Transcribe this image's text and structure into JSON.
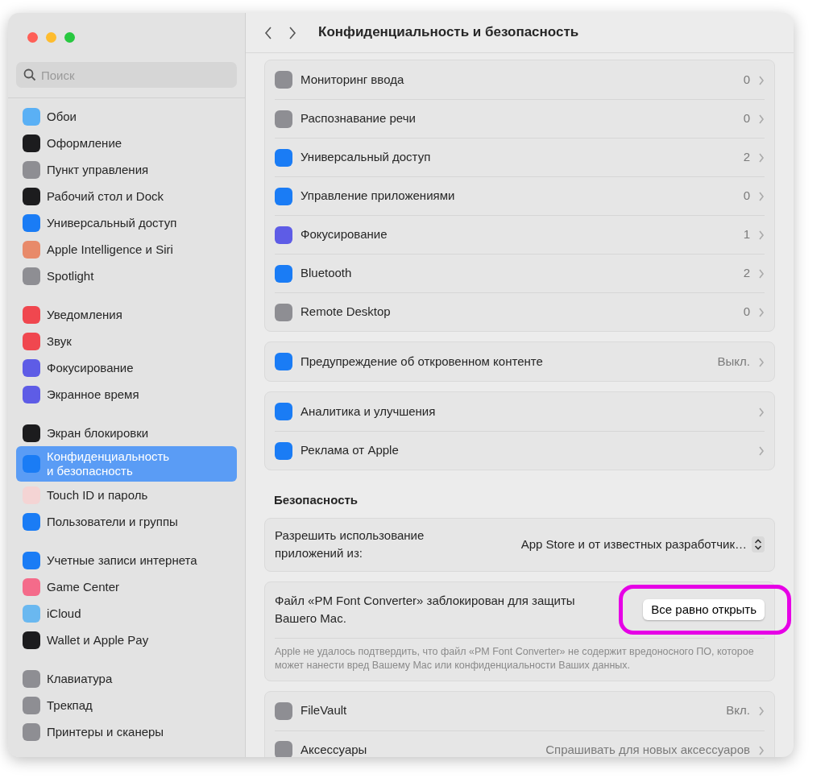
{
  "window": {
    "title": "Конфиденциальность и безопасность"
  },
  "search": {
    "placeholder": "Поиск"
  },
  "sidebar": {
    "groups": [
      [
        {
          "label": "Обои",
          "color": "#5ab0f5",
          "selected": false
        },
        {
          "label": "Оформление",
          "color": "#1c1c1e",
          "selected": false
        },
        {
          "label": "Пункт управления",
          "color": "#8e8e93",
          "selected": false
        },
        {
          "label": "Рабочий стол и Dock",
          "color": "#1c1c1e",
          "selected": false
        },
        {
          "label": "Универсальный доступ",
          "color": "#1a7cf5",
          "selected": false
        },
        {
          "label": "Apple Intelligence и Siri",
          "color": "#e88a6a",
          "selected": false
        },
        {
          "label": "Spotlight",
          "color": "#8e8e93",
          "selected": false
        }
      ],
      [
        {
          "label": "Уведомления",
          "color": "#f0474f",
          "selected": false
        },
        {
          "label": "Звук",
          "color": "#f0474f",
          "selected": false
        },
        {
          "label": "Фокусирование",
          "color": "#5e5ce6",
          "selected": false
        },
        {
          "label": "Экранное время",
          "color": "#5e5ce6",
          "selected": false
        }
      ],
      [
        {
          "label": "Экран блокировки",
          "color": "#1c1c1e",
          "selected": false
        },
        {
          "label": "Конфиденциальность\nи безопасность",
          "color": "#1a7cf5",
          "selected": true
        },
        {
          "label": "Touch ID и пароль",
          "color": "#f4d4d4",
          "selected": false
        },
        {
          "label": "Пользователи и группы",
          "color": "#1a7cf5",
          "selected": false
        }
      ],
      [
        {
          "label": "Учетные записи интернета",
          "color": "#1a7cf5",
          "selected": false
        },
        {
          "label": "Game Center",
          "color": "#f46b8a",
          "selected": false
        },
        {
          "label": "iCloud",
          "color": "#6ab8f0",
          "selected": false
        },
        {
          "label": "Wallet и Apple Pay",
          "color": "#1c1c1e",
          "selected": false
        }
      ],
      [
        {
          "label": "Клавиатура",
          "color": "#8e8e93",
          "selected": false
        },
        {
          "label": "Трекпад",
          "color": "#8e8e93",
          "selected": false
        },
        {
          "label": "Принтеры и сканеры",
          "color": "#8e8e93",
          "selected": false
        }
      ]
    ]
  },
  "privacy_groups": [
    [
      {
        "label": "Мониторинг ввода",
        "value": "0",
        "color": "#8e8e93"
      },
      {
        "label": "Распознавание речи",
        "value": "0",
        "color": "#8e8e93"
      },
      {
        "label": "Универсальный доступ",
        "value": "2",
        "color": "#1a7cf5"
      },
      {
        "label": "Управление приложениями",
        "value": "0",
        "color": "#1a7cf5"
      },
      {
        "label": "Фокусирование",
        "value": "1",
        "color": "#5e5ce6"
      },
      {
        "label": "Bluetooth",
        "value": "2",
        "color": "#1a7cf5"
      },
      {
        "label": "Remote Desktop",
        "value": "0",
        "color": "#8e8e93"
      }
    ],
    [
      {
        "label": "Предупреждение об откровенном контенте",
        "value": "Выкл.",
        "color": "#1a7cf5"
      }
    ],
    [
      {
        "label": "Аналитика и улучшения",
        "color": "#1a7cf5"
      },
      {
        "label": "Реклама от Apple",
        "color": "#1a7cf5"
      }
    ]
  ],
  "security": {
    "heading": "Безопасность",
    "allow": {
      "label": "Разрешить использование приложений из:",
      "value": "App Store и от известных разработчик…"
    },
    "blocked": {
      "message": "Файл «PM Font Converter» заблокирован для защиты Вашего Mac.",
      "button": "Все равно открыть",
      "annotated": true,
      "note": "Apple не удалось подтвердить, что файл «PM Font Converter» не содержит вредоносного ПО, которое может нанести вред Вашему Mac или конфиденциальности Ваших данных."
    },
    "rows": [
      {
        "label": "FileVault",
        "value": "Вкл.",
        "color": "#8e8e93"
      },
      {
        "label": "Аксессуары",
        "value": "Спрашивать для новых аксессуаров",
        "color": "#8e8e93"
      }
    ]
  }
}
